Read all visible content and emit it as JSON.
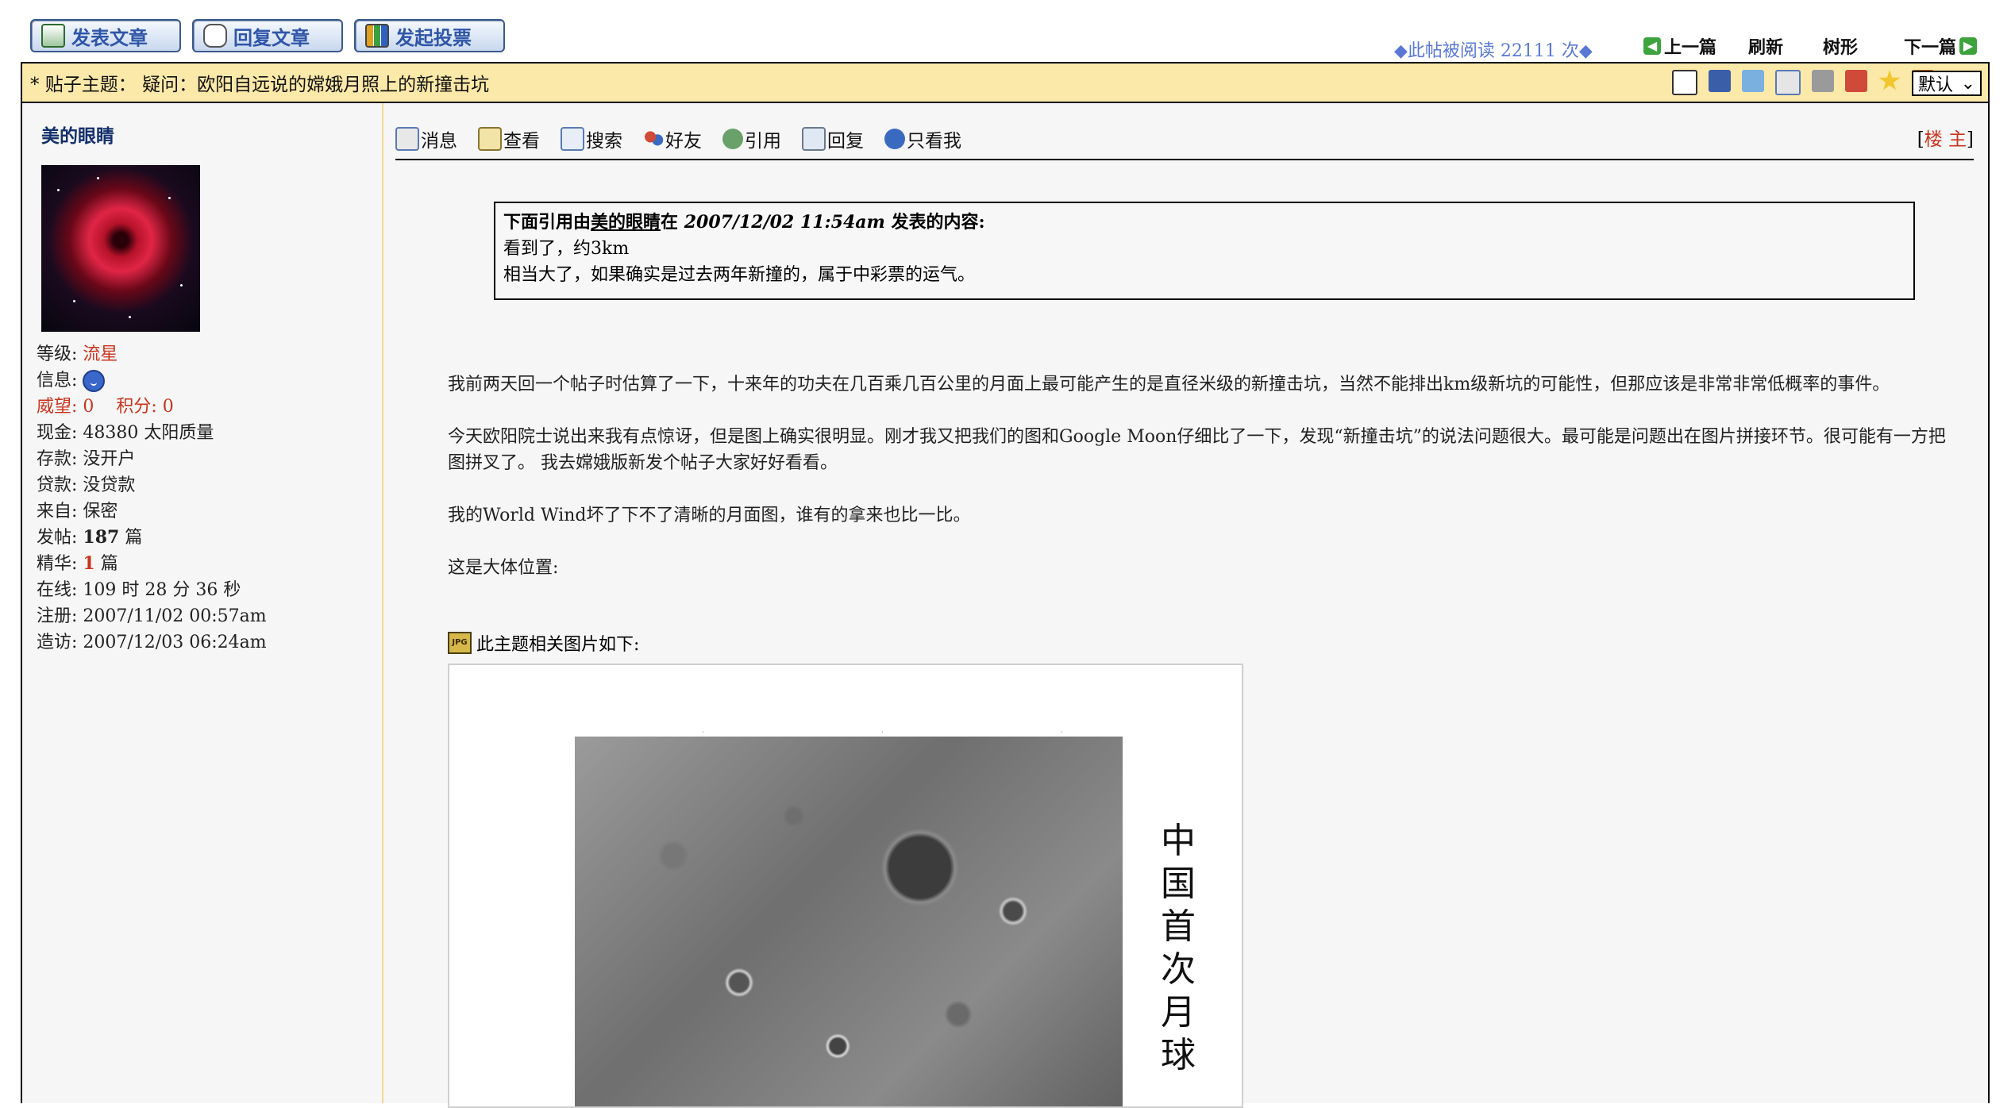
{
  "toolbar": {
    "new_post": "发表文章",
    "reply": "回复文章",
    "vote": "发起投票"
  },
  "read_count": "◆此帖被阅读 22111 次◆",
  "nav": {
    "prev": "上一篇",
    "refresh": "刷新",
    "tree": "树形",
    "next": "下一篇"
  },
  "titlebar": {
    "label": "* 贴子主题：  疑问：欧阳自远说的嫦娥月照上的新撞击坑",
    "theme": "默认"
  },
  "user": {
    "name": "美的眼睛",
    "level_label": "等级: ",
    "level": "流星",
    "msg_label": "信息: ",
    "prestige": "威望: 0",
    "points": "积分: 0",
    "cash": "现金: 48380 太阳质量",
    "deposit": "存款: 没开户",
    "loan": "贷款: 没贷款",
    "from": "来自: 保密",
    "posts_label": "发帖: ",
    "posts": "187",
    "posts_unit": " 篇",
    "elite_label": "精华: ",
    "elite": "1",
    "elite_unit": " 篇",
    "online": "在线: 109 时 28 分 36 秒",
    "registered": "注册: 2007/11/02 00:57am",
    "last_visit": "造访: 2007/12/03 06:24am"
  },
  "actions": [
    "消息",
    "查看",
    "搜索",
    "好友",
    "引用",
    "回复",
    "只看我"
  ],
  "floor": {
    "open": "[",
    "name": "楼 主",
    "close": "]"
  },
  "quote": {
    "pre": "下面引用由",
    "author": "美的眼睛",
    "mid": "在 ",
    "time": "2007/12/02 11:54am",
    "post": " 发表的内容:",
    "line1": "看到了，约3km",
    "line2": "相当大了，如果确实是过去两年新撞的，属于中彩票的运气。"
  },
  "body": {
    "p1": "我前两天回一个帖子时估算了一下，十来年的功夫在几百乘几百公里的月面上最可能产生的是直径米级的新撞击坑，当然不能排出km级新坑的可能性，但那应该是非常非常低概率的事件。",
    "p2": "今天欧阳院士说出来我有点惊讶，但是图上确实很明显。刚才我又把我们的图和Google Moon仔细比了一下，发现“新撞击坑”的说法问题很大。最可能是问题出在图片拼接环节。很可能有一方把图拼叉了。 我去嫦娥版新发个帖子大家好好看看。",
    "p3": "我的World Wind坏了下不了清晰的月面图，谁有的拿来也比一比。",
    "p4": "这是大体位置:"
  },
  "attachment": {
    "icon": "JPG",
    "label": "此主题相关图片如下:"
  },
  "image_caption": "中国首次月球",
  "icons": {
    "accent": "#2f55a8",
    "titlebar_bg": "#fbe9a9",
    "level_color": "#c8341e"
  }
}
